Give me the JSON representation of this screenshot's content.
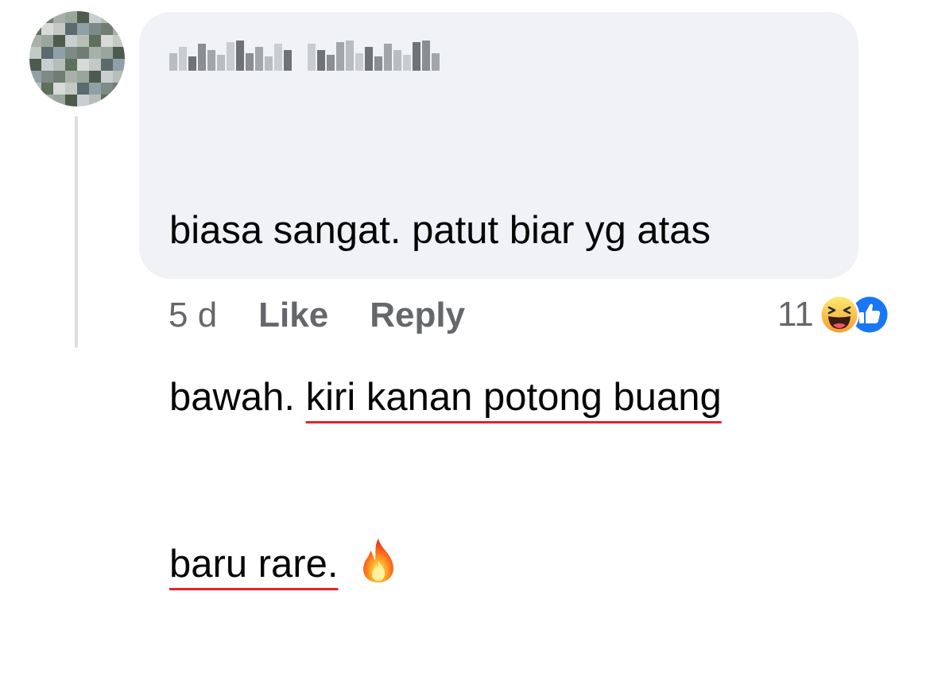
{
  "comment": {
    "author_name": "[blurred name]",
    "lines": [
      [
        "biasa sangat. patut biar yg atas"
      ],
      [
        "bawah. ",
        "kiri kanan potong buang"
      ],
      [
        "baru rare."
      ]
    ],
    "emoji": "fire-icon"
  },
  "meta": {
    "timestamp": "5 d",
    "like_label": "Like",
    "reply_label": "Reply"
  },
  "reactions": {
    "count": "11",
    "types": [
      "haha-icon",
      "like-icon"
    ]
  },
  "colors": {
    "bubble": "#f0f2f5",
    "text": "#050505",
    "secondary_text": "#65676b",
    "annotation_underline": "#e0242a",
    "like_blue": "#1877f2",
    "haha_yellow": "#f7b125"
  }
}
